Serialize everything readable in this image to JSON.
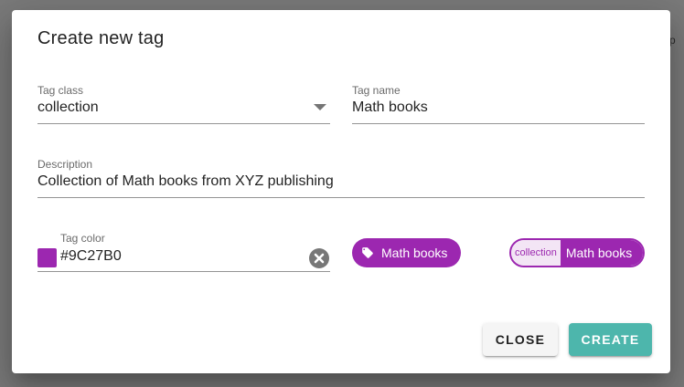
{
  "background": {
    "hint_text": "er p"
  },
  "dialog": {
    "title": "Create new tag",
    "tag_class": {
      "label": "Tag class",
      "value": "collection",
      "icon": "dropdown-arrow-icon"
    },
    "tag_name": {
      "label": "Tag name",
      "value": "Math books"
    },
    "description": {
      "label": "Description",
      "value": "Collection of Math books from XYZ publishing"
    },
    "tag_color": {
      "label": "Tag color",
      "value": "#9C27B0",
      "clear_icon": "close-circle-icon"
    },
    "preview_chip": {
      "icon": "tag-icon",
      "label": "Math books"
    },
    "preview_chip_full": {
      "class_label": "collection",
      "name_label": "Math books"
    },
    "buttons": {
      "close": "CLOSE",
      "create": "CREATE"
    }
  },
  "colors": {
    "tag_color": "#9C27B0",
    "create_button": "#4DB6AC",
    "underline": "#9e9e9e"
  }
}
